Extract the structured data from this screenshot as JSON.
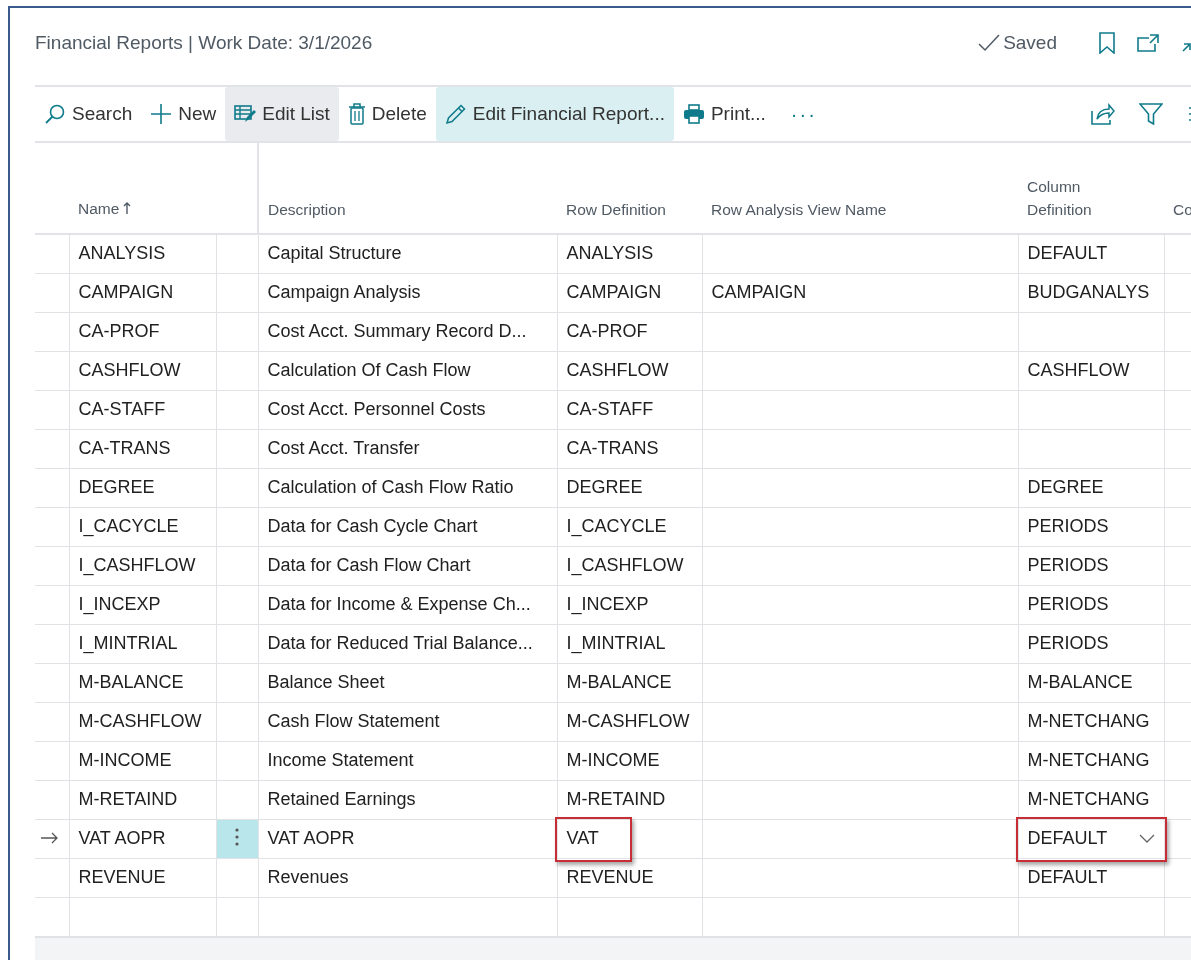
{
  "window": {
    "title": "Financial Reports | Work Date: 3/1/2026",
    "save_status": "Saved"
  },
  "toolbar": {
    "actions": [
      {
        "kind": "search",
        "label": "Search",
        "hovered": false,
        "focused": false
      },
      {
        "kind": "new",
        "label": "New",
        "hovered": false,
        "focused": false
      },
      {
        "kind": "edit-list",
        "label": "Edit List",
        "hovered": true,
        "focused": false
      },
      {
        "kind": "delete",
        "label": "Delete",
        "hovered": false,
        "focused": false
      },
      {
        "kind": "edit",
        "label": "Edit Financial Report...",
        "hovered": false,
        "focused": true
      },
      {
        "kind": "print",
        "label": "Print...",
        "hovered": false,
        "focused": false
      },
      {
        "kind": "more",
        "label": "···",
        "hovered": false,
        "focused": false
      }
    ]
  },
  "table": {
    "columns": [
      {
        "label": "Name",
        "sorted": true
      },
      {
        "label": "Description",
        "sorted": false
      },
      {
        "label": "Row Definition",
        "sorted": false
      },
      {
        "label": "Row Analysis View Name",
        "sorted": false
      },
      {
        "label": "Column Definition",
        "sorted": false
      },
      {
        "label": "Co",
        "sorted": false
      }
    ],
    "rows": [
      {
        "name": "ANALYSIS",
        "description": "Capital Structure",
        "row_definition": "ANALYSIS",
        "column_definition": "DEFAULT",
        "selected": false,
        "marked": false
      },
      {
        "name": "CAMPAIGN",
        "description": "Campaign Analysis",
        "row_definition": "CAMPAIGN",
        "row_analysis_view_name": "CAMPAIGN",
        "column_definition": "BUDGANALYS",
        "selected": false,
        "marked": false
      },
      {
        "name": "CA-PROF",
        "description": "Cost Acct. Summary Record D...",
        "row_definition": "CA-PROF",
        "selected": false,
        "marked": false
      },
      {
        "name": "CASHFLOW",
        "description": "Calculation Of Cash Flow",
        "row_definition": "CASHFLOW",
        "column_definition": "CASHFLOW",
        "selected": false,
        "marked": false
      },
      {
        "name": "CA-STAFF",
        "description": "Cost Acct. Personnel Costs",
        "row_definition": "CA-STAFF",
        "selected": false,
        "marked": false
      },
      {
        "name": "CA-TRANS",
        "description": "Cost Acct. Transfer",
        "row_definition": "CA-TRANS",
        "selected": false,
        "marked": false
      },
      {
        "name": "DEGREE",
        "description": "Calculation of Cash Flow Ratio",
        "row_definition": "DEGREE",
        "column_definition": "DEGREE",
        "selected": false,
        "marked": false
      },
      {
        "name": "I_CACYCLE",
        "description": "Data for Cash Cycle Chart",
        "row_definition": "I_CACYCLE",
        "column_definition": "PERIODS",
        "selected": false,
        "marked": false
      },
      {
        "name": "I_CASHFLOW",
        "description": "Data for Cash Flow Chart",
        "row_definition": "I_CASHFLOW",
        "column_definition": "PERIODS",
        "selected": false,
        "marked": false
      },
      {
        "name": "I_INCEXP",
        "description": "Data for Income & Expense Ch...",
        "row_definition": "I_INCEXP",
        "column_definition": "PERIODS",
        "selected": false,
        "marked": false
      },
      {
        "name": "I_MINTRIAL",
        "description": "Data for Reduced Trial Balance...",
        "row_definition": "I_MINTRIAL",
        "column_definition": "PERIODS",
        "selected": false,
        "marked": false
      },
      {
        "name": "M-BALANCE",
        "description": "Balance Sheet",
        "row_definition": "M-BALANCE",
        "column_definition": "M-BALANCE",
        "selected": false,
        "marked": false
      },
      {
        "name": "M-CASHFLOW",
        "description": "Cash Flow Statement",
        "row_definition": "M-CASHFLOW",
        "column_definition": "M-NETCHANG",
        "selected": false,
        "marked": false
      },
      {
        "name": "M-INCOME",
        "description": "Income Statement",
        "row_definition": "M-INCOME",
        "column_definition": "M-NETCHANG",
        "selected": false,
        "marked": false
      },
      {
        "name": "M-RETAIND",
        "description": "Retained Earnings",
        "row_definition": "M-RETAIND",
        "column_definition": "M-NETCHANG",
        "selected": false,
        "marked": false
      },
      {
        "name": "VAT AOPR",
        "description": "VAT AOPR",
        "row_definition": "VAT",
        "column_definition": "DEFAULT",
        "selected": true,
        "marked": true
      },
      {
        "name": "REVENUE",
        "description": "Revenues",
        "row_definition": "REVENUE",
        "column_definition": "DEFAULT",
        "selected": false,
        "marked": false
      }
    ]
  }
}
